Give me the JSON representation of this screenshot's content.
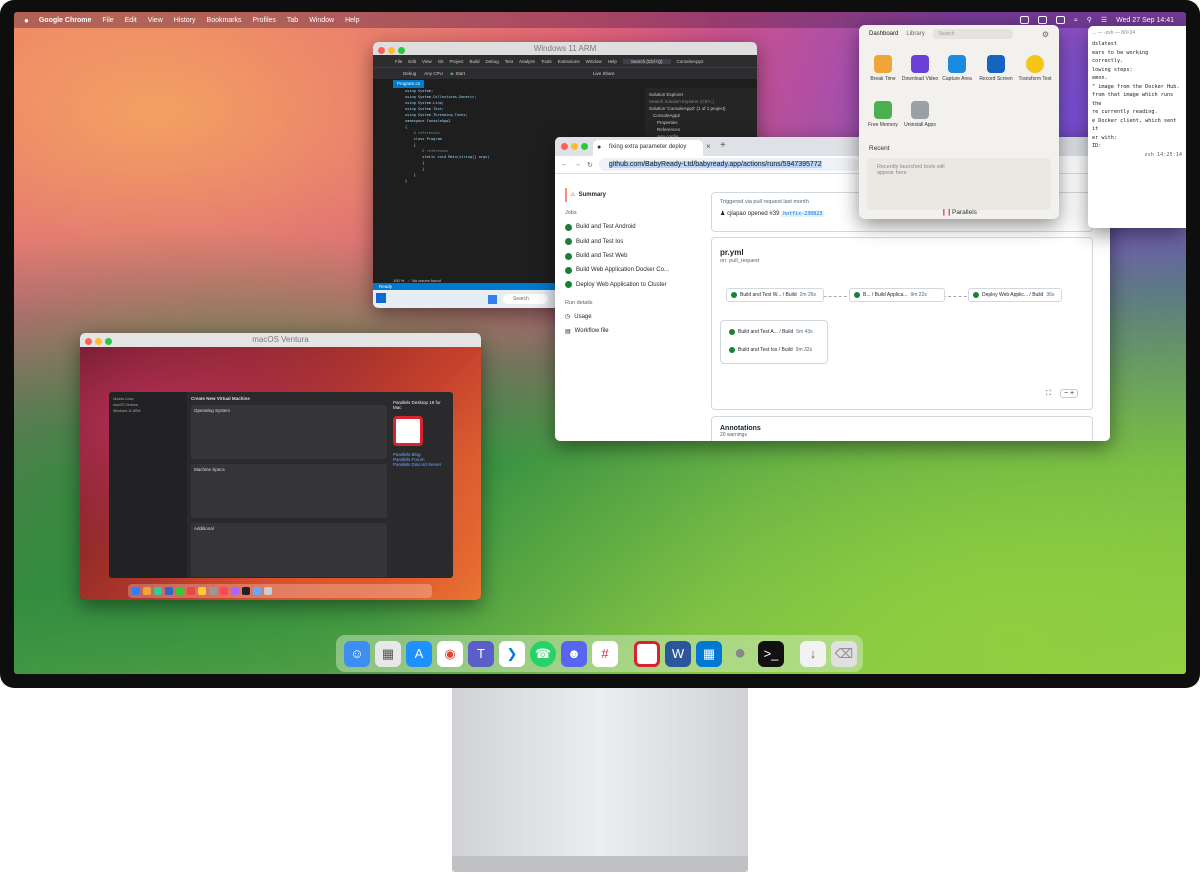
{
  "menubar": {
    "apple": "",
    "items": [
      "Google Chrome",
      "File",
      "Edit",
      "View",
      "History",
      "Bookmarks",
      "Profiles",
      "Tab",
      "Window",
      "Help"
    ],
    "datetime": "Wed 27 Sep  14:41"
  },
  "vs_window": {
    "title": "Windows 11 ARM",
    "menu": [
      "File",
      "Edit",
      "View",
      "Git",
      "Project",
      "Build",
      "Debug",
      "Test",
      "Analyze",
      "Tools",
      "Extensions",
      "Window",
      "Help"
    ],
    "search": "Search (Ctrl+Q)",
    "project": "ConsoleApp2",
    "toolbar": [
      "Debug",
      "Any CPU",
      "Start",
      "Live Share"
    ],
    "tab_label": "Program.cs",
    "code_lines": [
      "using System;",
      "using System.Collections.Generic;",
      "using System.Linq;",
      "using System.Text;",
      "using System.Threading.Tasks;",
      "",
      "namespace ConsoleApp2",
      "{",
      "    0 references",
      "    class Program",
      "    {",
      "        0 references",
      "        static void Main(string[] args)",
      "        {",
      "",
      "        }",
      "    }",
      "}"
    ],
    "solution_title": "Solution Explorer",
    "solution_items": [
      "Search Solution Explorer (Ctrl+;)",
      "Solution 'ConsoleApp2' (1 of 1 project)",
      "ConsoleApp2",
      "Properties",
      "References",
      "App.config",
      "Program.cs"
    ],
    "status_zoom": "100 %",
    "status_issues": "No issues found",
    "status": "Ready",
    "taskbar_search": "Search"
  },
  "ventura_window": {
    "title": "macOS Ventura",
    "pd_sidebar": [
      "Ubuntu Linux",
      "macOS Ventura",
      "Windows 11 ARM"
    ],
    "pd_heading": "Create New Virtual Machine",
    "pd_panels": [
      "Operating System",
      "Machine Specs",
      "Additional"
    ],
    "pd_right_title": "Parallels Desktop 19 for Mac",
    "pd_right_links": [
      "Parallels Blog",
      "Parallels Forum",
      "Parallels Discord Server"
    ]
  },
  "chrome": {
    "tab_title": "fixing extra parameter deploy",
    "url": "github.com/BabyReady-Ltd/babyready.app/actions/runs/5947395772",
    "summary": "Summary",
    "jobs_label": "Jobs",
    "jobs": [
      "Build and Test Android",
      "Build and Test Ios",
      "Build and Test Web",
      "Build Web Application Docker Co...",
      "Deploy Web Application to Cluster"
    ],
    "run_details_label": "Run details",
    "run_details": [
      "Usage",
      "Workflow file"
    ],
    "trigger_text": "Triggered via pull request last month",
    "trigger_user": "cjlapao opened #39",
    "trigger_branch": "hotfix-230823",
    "workflow_file": "pr.yml",
    "workflow_event": "on: pull_request",
    "graph_jobs": [
      {
        "label": "Build and Test W... / Build",
        "time": "2m 26s"
      },
      {
        "label": "B... / Build Applica...",
        "time": "9m 22s"
      },
      {
        "label": "Deploy Web Applic... / Build",
        "time": "36s"
      },
      {
        "label": "Build and Test A... / Build",
        "time": "5m 43s"
      },
      {
        "label": "Build and Test Ios / Build",
        "time": "9m 32s"
      }
    ],
    "annotations": "Annotations",
    "annotations_count": "20 warnings"
  },
  "terminal": {
    "title": "... — -zsh — 80×24",
    "lines": [
      "dslatest",
      "",
      "ears to be working correctly.",
      "",
      "lowing steps:",
      "emon.",
      "\" image from the Docker Hub.",
      "",
      "from that image which runs the",
      "re currently reading.",
      "e Docker client, which sent it",
      "",
      "",
      "er with:",
      "",
      "ID:",
      "",
      "",
      "",
      "",
      "zsh   14:25:14"
    ]
  },
  "parallels_popover": {
    "tabs": [
      "Dashboard",
      "Library"
    ],
    "search": "Search",
    "tools": [
      "Break Time",
      "Download Video",
      "Capture Area",
      "Record Screen",
      "Transform Text",
      "Free Memory",
      "Uninstall Apps"
    ],
    "recent_label": "Recent",
    "recent_empty": "Recently launched tools will appear here",
    "brand": "Parallels"
  },
  "dock": {
    "apps": [
      "Finder",
      "Launchpad",
      "App Store",
      "Google Chrome",
      "Microsoft Teams",
      "Visual Studio Code",
      "WhatsApp",
      "Discord",
      "Slack",
      "Parallels Desktop",
      "Microsoft Word",
      "Windows 11",
      "macOS",
      "Terminal",
      "Downloads",
      "Trash"
    ]
  },
  "colors": {
    "github_success": "#1a7f37",
    "vs_status": "#007acc",
    "parallels_red": "#d9232f"
  }
}
